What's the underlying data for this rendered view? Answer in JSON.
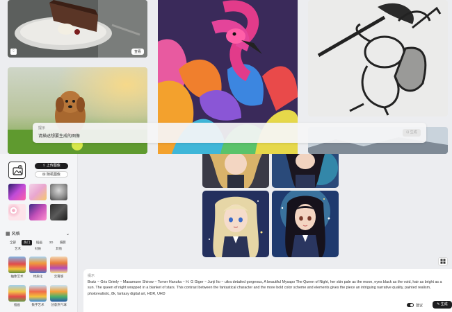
{
  "gallery": {
    "cake_tile_button": "查看"
  },
  "prompt_bar": {
    "label": "提示",
    "placeholder": "请描述想要生成的图像",
    "generate_label": "生成"
  },
  "left_panel": {
    "upload_button": "上传图像",
    "random_button": "随机图像",
    "section_title": "风格",
    "chips_row1": [
      "全部",
      "热门",
      "插画",
      "3D",
      "摄影"
    ],
    "chips_row2": [
      "艺术",
      "材质",
      "其他"
    ],
    "styles": [
      {
        "label": "抽象艺术"
      },
      {
        "label": "材质化"
      },
      {
        "label": "云雾感"
      },
      {
        "label": "插画"
      },
      {
        "label": "数字艺术"
      },
      {
        "label": "创意热气球"
      }
    ]
  },
  "prompt_display": {
    "label": "提示",
    "text": "Bratz ~ Gris Grimly ~ Masamune Shirow ~ Tomer Hanuka ~ H. G Giger ~ Junji Ito ~ ultra detailed gorgeous, A beautiful Mysapo The Queen of Night, her skin pale as the moon, eyes black as the void, hair as bright as a sun. The queen of night wrapped in a blanket of stars. This contrast between the fantastical character and the more bold color scheme and elements gives the piece an intriguing narrative quality, painted realism, photorealistic, 8k, fantasy digital art, HDR, UHD",
    "toggle_label": "建议",
    "generate_label": "生成"
  }
}
